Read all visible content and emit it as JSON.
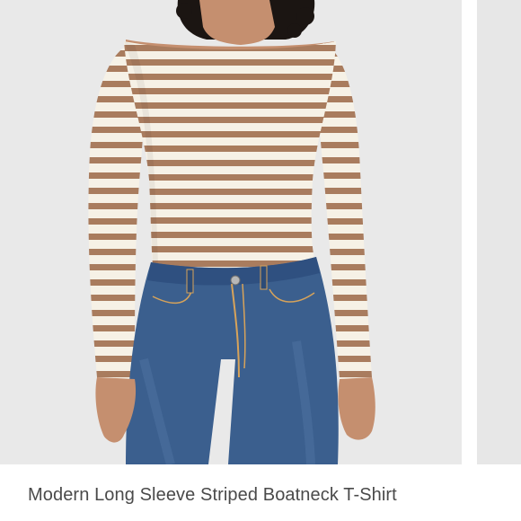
{
  "listing": {
    "title": "Modern Long Sleeve Striped Boatneck T-Shirt",
    "photo": {
      "description_icon": "product-photo",
      "colors": {
        "background": "#e9e9e9",
        "shirt_base": "#f6f1e6",
        "stripe": "#a97c5e",
        "denim": "#3b5f8e",
        "skin": "#c58f6f",
        "hair": "#1b1512"
      }
    }
  }
}
